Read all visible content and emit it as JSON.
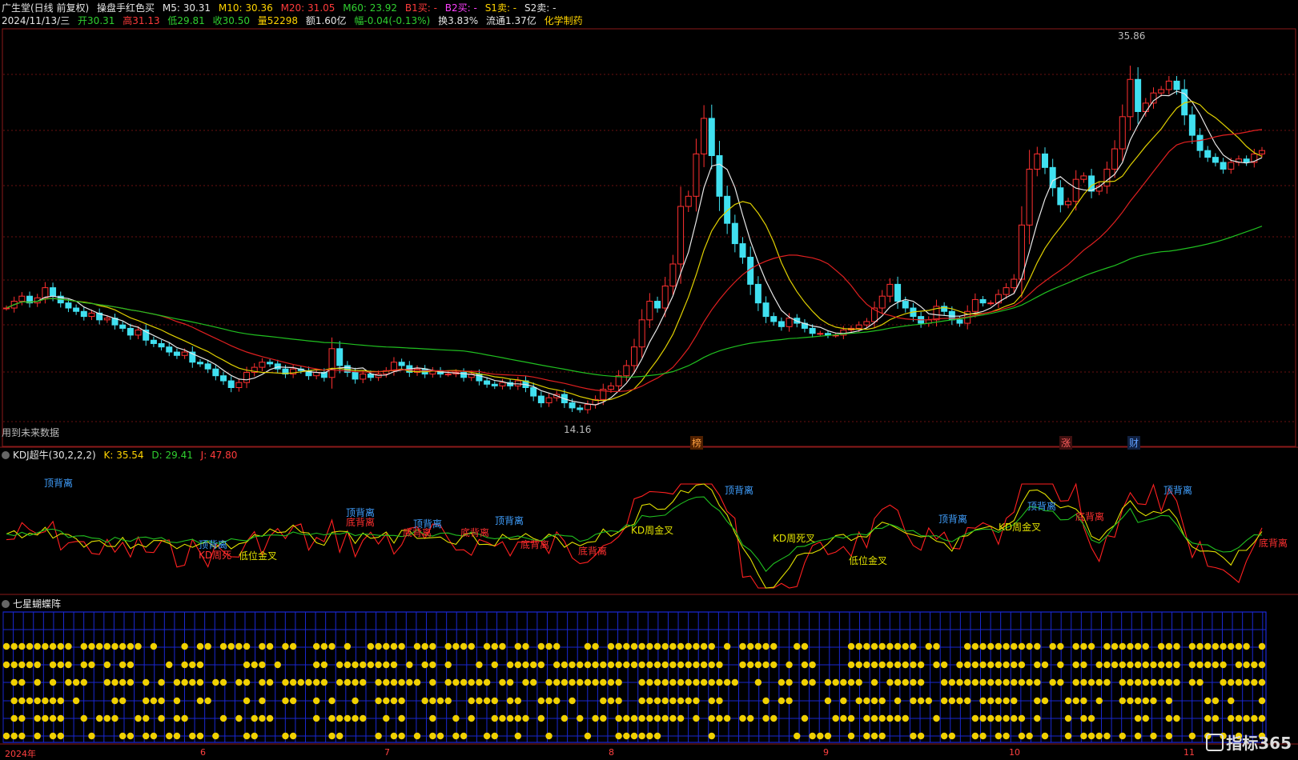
{
  "header": {
    "stock": "广生堂(日线 前复权)",
    "indicator": "操盘手红色买",
    "m5": "M5: 30.31",
    "m10": "M10: 30.36",
    "m20": "M20: 31.05",
    "m60": "M60: 23.92",
    "b1": "B1买: -",
    "b2": "B2买: -",
    "s1": "S1卖: -",
    "s2": "S2卖: -",
    "date": "2024/11/13/三",
    "open": "开30.31",
    "high": "高31.13",
    "low": "低29.81",
    "close": "收30.50",
    "volume": "量52298",
    "amount": "额1.60亿",
    "change": "幅-0.04(-0.13%)",
    "turnover": "换3.83%",
    "float": "流通1.37亿",
    "sector": "化学制药"
  },
  "main": {
    "high_label": "35.86",
    "low_label": "14.16",
    "future_note": "用到未来数据",
    "badges": [
      "榜",
      "涨",
      "财"
    ]
  },
  "kdj": {
    "title": "KDJ超牛(30,2,2,2)",
    "k": "K: 35.54",
    "d": "D: 29.41",
    "j": "J: 47.80",
    "labels": [
      "顶背离",
      "顶背离",
      "KD周死",
      "低位金叉",
      "顶背离",
      "底背离",
      "顶背离",
      "底背离",
      "底背离",
      "顶背离",
      "底背离",
      "底背离",
      "KD周金叉",
      "顶背离",
      "KD周死叉",
      "低位金叉",
      "顶背离",
      "KD周金叉",
      "顶背离",
      "底背离",
      "顶背离",
      "底背离"
    ]
  },
  "butterfly": {
    "title": "七星蝴蝶阵"
  },
  "xaxis": {
    "labels": [
      "2024年",
      "6",
      "7",
      "8",
      "9",
      "10",
      "11"
    ]
  },
  "brand": "指标365",
  "chart_data": {
    "type": "candlestick",
    "high": 35.86,
    "low": 14.16,
    "series": [
      {
        "name": "M5",
        "value": 30.31
      },
      {
        "name": "M10",
        "value": 30.36
      },
      {
        "name": "M20",
        "value": 31.05
      },
      {
        "name": "M60",
        "value": 23.92
      }
    ],
    "close": [
      21.2,
      21.6,
      21.9,
      21.5,
      21.8,
      22.4,
      21.9,
      21.5,
      21.2,
      21.0,
      20.7,
      20.9,
      20.5,
      20.6,
      20.2,
      20.0,
      19.6,
      19.9,
      19.3,
      19.1,
      18.9,
      18.6,
      18.4,
      18.6,
      18.0,
      17.9,
      17.6,
      17.2,
      16.9,
      16.5,
      16.8,
      17.4,
      17.7,
      18.0,
      17.9,
      17.6,
      17.3,
      17.6,
      17.5,
      17.2,
      17.4,
      17.1,
      18.8,
      17.8,
      17.4,
      17.0,
      17.3,
      17.1,
      17.3,
      17.5,
      18.0,
      17.8,
      17.4,
      17.6,
      17.3,
      17.5,
      17.3,
      17.3,
      17.4,
      17.1,
      17.3,
      16.9,
      16.7,
      16.6,
      16.8,
      16.6,
      16.9,
      16.5,
      16.0,
      15.6,
      15.9,
      16.1,
      15.6,
      15.3,
      15.2,
      15.5,
      15.8,
      16.4,
      16.6,
      17.2,
      17.8,
      18.9,
      20.5,
      21.6,
      21.2,
      22.5,
      23.8,
      27.2,
      27.8,
      30.3,
      32.4,
      30.2,
      27.8,
      26.2,
      25.0,
      24.2,
      22.6,
      21.5,
      20.7,
      20.4,
      20.1,
      20.6,
      20.3,
      20.0,
      19.7,
      19.7,
      19.6,
      19.6,
      19.9,
      20.0,
      20.2,
      20.4,
      21.2,
      21.9,
      22.6,
      21.6,
      21.2,
      20.7,
      20.3,
      20.5,
      21.3,
      21.0,
      20.5,
      20.3,
      21.0,
      21.7,
      21.5,
      21.5,
      22.0,
      22.4,
      22.9,
      26.1,
      29.4,
      30.3,
      29.5,
      28.3,
      27.3,
      27.5,
      28.8,
      29.0,
      28.1,
      28.4,
      29.4,
      30.6,
      32.5,
      34.7,
      32.8,
      33.3,
      33.9,
      34.1,
      34.6,
      34.1,
      32.6,
      31.4,
      30.5,
      30.1,
      29.8,
      29.4,
      29.8,
      30.0,
      29.8,
      30.3,
      30.5
    ]
  }
}
